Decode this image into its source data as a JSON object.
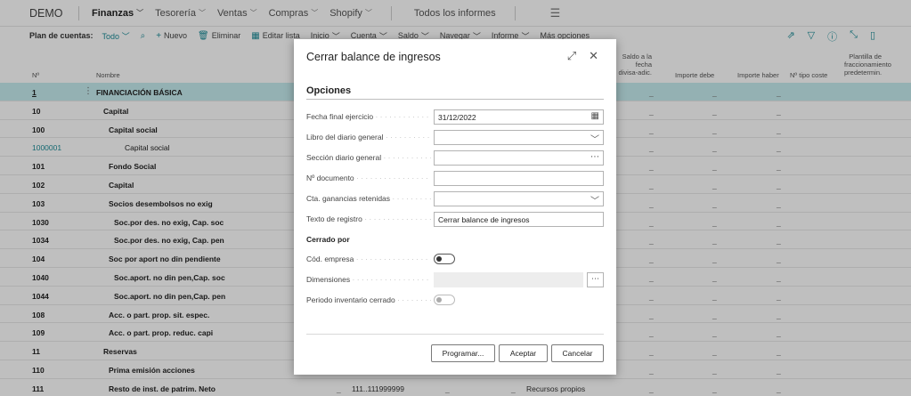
{
  "topnav": {
    "company": "DEMO",
    "menus": [
      "Finanzas",
      "Tesorería",
      "Ventas",
      "Compras",
      "Shopify"
    ],
    "all_reports": "Todos los informes"
  },
  "actionbar": {
    "plan_label": "Plan de cuentas:",
    "plan_value": "Todo",
    "actions": [
      "Nuevo",
      "Eliminar",
      "Editar lista",
      "Inicio",
      "Cuenta",
      "Saldo",
      "Navegar",
      "Informe",
      "Más opciones"
    ]
  },
  "grid": {
    "headers": {
      "no": "Nº",
      "name": "Nombre",
      "saldo_divisa": "Saldo a la fecha divisa-adic.",
      "importe_debe": "Importe debe",
      "importe_haber": "Importe haber",
      "tipo_coste": "Nº tipo coste",
      "plantilla": "Plantilla de fraccionamiento predetermin."
    },
    "rows": [
      {
        "no": "1",
        "name": "FINANCIACIÓN BÁSICA",
        "indent": 0,
        "bold": true
      },
      {
        "no": "10",
        "name": "Capital",
        "indent": 1,
        "bold": true
      },
      {
        "no": "100",
        "name": "Capital social",
        "indent": 2,
        "bold": true
      },
      {
        "no": "1000001",
        "name": "Capital social",
        "indent": 3,
        "bold": false
      },
      {
        "no": "101",
        "name": "Fondo Social",
        "indent": 2,
        "bold": true
      },
      {
        "no": "102",
        "name": "Capital",
        "indent": 2,
        "bold": true
      },
      {
        "no": "103",
        "name": "Socios desembolsos no exig",
        "indent": 2,
        "bold": true
      },
      {
        "no": "1030",
        "name": "Soc.por des. no exig, Cap. soc",
        "indent": 3,
        "bold": true
      },
      {
        "no": "1034",
        "name": "Soc.por des. no exig, Cap. pen",
        "indent": 3,
        "bold": true
      },
      {
        "no": "104",
        "name": "Soc por aport no din pendiente",
        "indent": 2,
        "bold": true
      },
      {
        "no": "1040",
        "name": "Soc.aport. no din pen,Cap. soc",
        "indent": 3,
        "bold": true
      },
      {
        "no": "1044",
        "name": "Soc.aport. no din pen,Cap. pen",
        "indent": 3,
        "bold": true
      },
      {
        "no": "108",
        "name": "Acc. o part. prop. sit. espec.",
        "indent": 2,
        "bold": true
      },
      {
        "no": "109",
        "name": "Acc. o part. prop. reduc. capi",
        "indent": 2,
        "bold": true
      },
      {
        "no": "11",
        "name": "Reservas",
        "indent": 1,
        "bold": true
      },
      {
        "no": "110",
        "name": "Prima emisión acciones",
        "indent": 2,
        "bold": true
      },
      {
        "no": "111",
        "name": "Resto de inst. de patrim. Neto",
        "indent": 2,
        "bold": true
      }
    ],
    "last_row_extra": {
      "range": "111..111999999",
      "category": "Recursos propios"
    }
  },
  "dialog": {
    "title": "Cerrar balance de ingresos",
    "section": "Opciones",
    "fields": {
      "fecha_label": "Fecha final ejercicio",
      "fecha_value": "31/12/2022",
      "libro_label": "Libro del diario general",
      "libro_value": "",
      "seccion_label": "Sección diario general",
      "seccion_value": "",
      "documento_label": "Nº documento",
      "documento_value": "",
      "cta_label": "Cta. ganancias retenidas",
      "cta_value": "",
      "texto_label": "Texto de registro",
      "texto_value": "Cerrar balance de ingresos"
    },
    "cerrado_por": "Cerrado por",
    "cod_empresa_label": "Cód. empresa",
    "dimensiones_label": "Dimensiones",
    "periodo_label": "Periodo inventario cerrado",
    "buttons": {
      "programar": "Programar...",
      "aceptar": "Aceptar",
      "cancelar": "Cancelar"
    }
  }
}
